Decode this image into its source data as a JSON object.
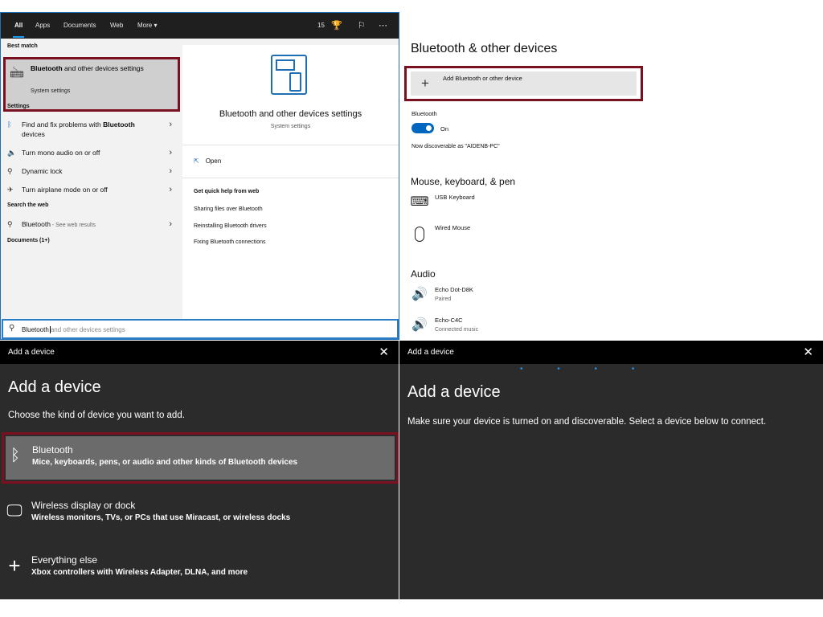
{
  "search_panel": {
    "tabs": [
      "All",
      "Apps",
      "Documents",
      "Web",
      "More ▾"
    ],
    "count": "15",
    "sections": {
      "best_match": "Best match",
      "settings": "Settings",
      "search_web": "Search the web",
      "documents": "Documents (1+)"
    },
    "best_match": {
      "title_bold": "Bluetooth",
      "title_rest": " and other devices settings",
      "subtitle": "System settings"
    },
    "settings_items": [
      {
        "pre": "Find and fix problems with ",
        "bold": "Bluetooth",
        "post": " devices"
      },
      {
        "label": "Turn mono audio on or off"
      },
      {
        "label": "Dynamic lock"
      },
      {
        "label": "Turn airplane mode on or off"
      }
    ],
    "web_item": {
      "label": "Bluetooth",
      "suffix": " - See web results"
    },
    "preview": {
      "title": "Bluetooth and other devices settings",
      "subtitle": "System settings",
      "open": "Open",
      "help_title": "Get quick help from web",
      "help_links": [
        "Sharing files over Bluetooth",
        "Reinstalling Bluetooth drivers",
        "Fixing Bluetooth connections"
      ]
    },
    "search_box": {
      "typed": "Bluetooth",
      "ghost": "and other devices settings"
    }
  },
  "settings_panel": {
    "title": "Bluetooth & other devices",
    "add_button": "Add Bluetooth or other device",
    "bluetooth_label": "Bluetooth",
    "toggle_state": "On",
    "discoverable": "Now discoverable as \"AIDENB-PC\"",
    "mouse_section": "Mouse, keyboard, & pen",
    "input_devices": [
      {
        "name": "USB Keyboard",
        "icon": "keyboard-icon"
      },
      {
        "name": "Wired Mouse",
        "icon": "mouse-icon"
      }
    ],
    "audio_section": "Audio",
    "audio_devices": [
      {
        "name": "Echo Dot-D8K",
        "status": "Paired"
      },
      {
        "name": "Echo-C4C",
        "status": "Connected music"
      }
    ]
  },
  "add_device_dialog": {
    "bar_title": "Add a device",
    "heading": "Add a device",
    "prompt": "Choose the kind of device you want to add.",
    "options": [
      {
        "name": "Bluetooth",
        "desc": "Mice, keyboards, pens, or audio and other kinds of Bluetooth devices"
      },
      {
        "name": "Wireless display or dock",
        "desc": "Wireless monitors, TVs, or PCs that use Miracast, or wireless docks"
      },
      {
        "name": "Everything else",
        "desc": "Xbox controllers with Wireless Adapter, DLNA, and more"
      }
    ]
  },
  "scanning_dialog": {
    "bar_title": "Add a device",
    "heading": "Add a device",
    "message": "Make sure your device is turned on and discoverable. Select a device below to connect."
  },
  "colors": {
    "highlight_border": "#7b1020",
    "accent": "#0067c0",
    "dialog_bg": "#2b2b2b"
  }
}
